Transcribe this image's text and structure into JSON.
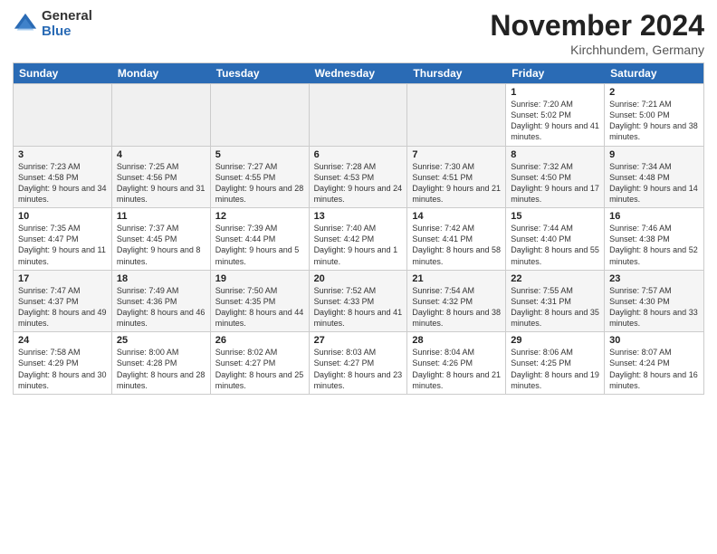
{
  "logo": {
    "general": "General",
    "blue": "Blue"
  },
  "header": {
    "month": "November 2024",
    "location": "Kirchhundem, Germany"
  },
  "weekdays": [
    "Sunday",
    "Monday",
    "Tuesday",
    "Wednesday",
    "Thursday",
    "Friday",
    "Saturday"
  ],
  "weeks": [
    [
      {
        "day": "",
        "empty": true
      },
      {
        "day": "",
        "empty": true
      },
      {
        "day": "",
        "empty": true
      },
      {
        "day": "",
        "empty": true
      },
      {
        "day": "",
        "empty": true
      },
      {
        "day": "1",
        "sunrise": "Sunrise: 7:20 AM",
        "sunset": "Sunset: 5:02 PM",
        "daylight": "Daylight: 9 hours and 41 minutes."
      },
      {
        "day": "2",
        "sunrise": "Sunrise: 7:21 AM",
        "sunset": "Sunset: 5:00 PM",
        "daylight": "Daylight: 9 hours and 38 minutes."
      }
    ],
    [
      {
        "day": "3",
        "sunrise": "Sunrise: 7:23 AM",
        "sunset": "Sunset: 4:58 PM",
        "daylight": "Daylight: 9 hours and 34 minutes."
      },
      {
        "day": "4",
        "sunrise": "Sunrise: 7:25 AM",
        "sunset": "Sunset: 4:56 PM",
        "daylight": "Daylight: 9 hours and 31 minutes."
      },
      {
        "day": "5",
        "sunrise": "Sunrise: 7:27 AM",
        "sunset": "Sunset: 4:55 PM",
        "daylight": "Daylight: 9 hours and 28 minutes."
      },
      {
        "day": "6",
        "sunrise": "Sunrise: 7:28 AM",
        "sunset": "Sunset: 4:53 PM",
        "daylight": "Daylight: 9 hours and 24 minutes."
      },
      {
        "day": "7",
        "sunrise": "Sunrise: 7:30 AM",
        "sunset": "Sunset: 4:51 PM",
        "daylight": "Daylight: 9 hours and 21 minutes."
      },
      {
        "day": "8",
        "sunrise": "Sunrise: 7:32 AM",
        "sunset": "Sunset: 4:50 PM",
        "daylight": "Daylight: 9 hours and 17 minutes."
      },
      {
        "day": "9",
        "sunrise": "Sunrise: 7:34 AM",
        "sunset": "Sunset: 4:48 PM",
        "daylight": "Daylight: 9 hours and 14 minutes."
      }
    ],
    [
      {
        "day": "10",
        "sunrise": "Sunrise: 7:35 AM",
        "sunset": "Sunset: 4:47 PM",
        "daylight": "Daylight: 9 hours and 11 minutes."
      },
      {
        "day": "11",
        "sunrise": "Sunrise: 7:37 AM",
        "sunset": "Sunset: 4:45 PM",
        "daylight": "Daylight: 9 hours and 8 minutes."
      },
      {
        "day": "12",
        "sunrise": "Sunrise: 7:39 AM",
        "sunset": "Sunset: 4:44 PM",
        "daylight": "Daylight: 9 hours and 5 minutes."
      },
      {
        "day": "13",
        "sunrise": "Sunrise: 7:40 AM",
        "sunset": "Sunset: 4:42 PM",
        "daylight": "Daylight: 9 hours and 1 minute."
      },
      {
        "day": "14",
        "sunrise": "Sunrise: 7:42 AM",
        "sunset": "Sunset: 4:41 PM",
        "daylight": "Daylight: 8 hours and 58 minutes."
      },
      {
        "day": "15",
        "sunrise": "Sunrise: 7:44 AM",
        "sunset": "Sunset: 4:40 PM",
        "daylight": "Daylight: 8 hours and 55 minutes."
      },
      {
        "day": "16",
        "sunrise": "Sunrise: 7:46 AM",
        "sunset": "Sunset: 4:38 PM",
        "daylight": "Daylight: 8 hours and 52 minutes."
      }
    ],
    [
      {
        "day": "17",
        "sunrise": "Sunrise: 7:47 AM",
        "sunset": "Sunset: 4:37 PM",
        "daylight": "Daylight: 8 hours and 49 minutes."
      },
      {
        "day": "18",
        "sunrise": "Sunrise: 7:49 AM",
        "sunset": "Sunset: 4:36 PM",
        "daylight": "Daylight: 8 hours and 46 minutes."
      },
      {
        "day": "19",
        "sunrise": "Sunrise: 7:50 AM",
        "sunset": "Sunset: 4:35 PM",
        "daylight": "Daylight: 8 hours and 44 minutes."
      },
      {
        "day": "20",
        "sunrise": "Sunrise: 7:52 AM",
        "sunset": "Sunset: 4:33 PM",
        "daylight": "Daylight: 8 hours and 41 minutes."
      },
      {
        "day": "21",
        "sunrise": "Sunrise: 7:54 AM",
        "sunset": "Sunset: 4:32 PM",
        "daylight": "Daylight: 8 hours and 38 minutes."
      },
      {
        "day": "22",
        "sunrise": "Sunrise: 7:55 AM",
        "sunset": "Sunset: 4:31 PM",
        "daylight": "Daylight: 8 hours and 35 minutes."
      },
      {
        "day": "23",
        "sunrise": "Sunrise: 7:57 AM",
        "sunset": "Sunset: 4:30 PM",
        "daylight": "Daylight: 8 hours and 33 minutes."
      }
    ],
    [
      {
        "day": "24",
        "sunrise": "Sunrise: 7:58 AM",
        "sunset": "Sunset: 4:29 PM",
        "daylight": "Daylight: 8 hours and 30 minutes."
      },
      {
        "day": "25",
        "sunrise": "Sunrise: 8:00 AM",
        "sunset": "Sunset: 4:28 PM",
        "daylight": "Daylight: 8 hours and 28 minutes."
      },
      {
        "day": "26",
        "sunrise": "Sunrise: 8:02 AM",
        "sunset": "Sunset: 4:27 PM",
        "daylight": "Daylight: 8 hours and 25 minutes."
      },
      {
        "day": "27",
        "sunrise": "Sunrise: 8:03 AM",
        "sunset": "Sunset: 4:27 PM",
        "daylight": "Daylight: 8 hours and 23 minutes."
      },
      {
        "day": "28",
        "sunrise": "Sunrise: 8:04 AM",
        "sunset": "Sunset: 4:26 PM",
        "daylight": "Daylight: 8 hours and 21 minutes."
      },
      {
        "day": "29",
        "sunrise": "Sunrise: 8:06 AM",
        "sunset": "Sunset: 4:25 PM",
        "daylight": "Daylight: 8 hours and 19 minutes."
      },
      {
        "day": "30",
        "sunrise": "Sunrise: 8:07 AM",
        "sunset": "Sunset: 4:24 PM",
        "daylight": "Daylight: 8 hours and 16 minutes."
      }
    ]
  ]
}
